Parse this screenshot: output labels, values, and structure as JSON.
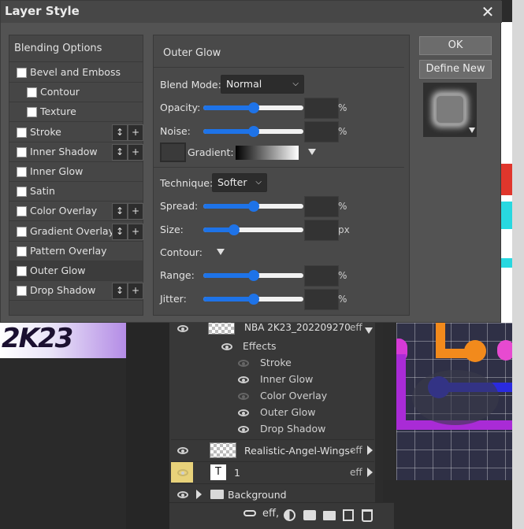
{
  "dialog": {
    "title": "Layer Style",
    "close_glyph": "✕",
    "ok_label": "OK",
    "define_new_label": "Define New",
    "options": {
      "header": "Blending Options",
      "items": [
        {
          "label": "Bevel and Emboss",
          "indent": false,
          "checked": false,
          "controls": false
        },
        {
          "label": "Contour",
          "indent": true,
          "checked": false,
          "controls": false
        },
        {
          "label": "Texture",
          "indent": true,
          "checked": false,
          "controls": false
        },
        {
          "label": "Stroke",
          "indent": false,
          "checked": false,
          "controls": true
        },
        {
          "label": "Inner Shadow",
          "indent": false,
          "checked": false,
          "controls": true
        },
        {
          "label": "Inner Glow",
          "indent": false,
          "checked": false,
          "controls": false
        },
        {
          "label": "Satin",
          "indent": false,
          "checked": false,
          "controls": false
        },
        {
          "label": "Color Overlay",
          "indent": false,
          "checked": false,
          "controls": true
        },
        {
          "label": "Gradient Overlay",
          "indent": false,
          "checked": false,
          "controls": true
        },
        {
          "label": "Pattern Overlay",
          "indent": false,
          "checked": false,
          "controls": false
        },
        {
          "label": "Outer Glow",
          "indent": false,
          "checked": false,
          "controls": false,
          "selected": true
        },
        {
          "label": "Drop Shadow",
          "indent": false,
          "checked": false,
          "controls": true
        }
      ],
      "move_glyph": "↕",
      "add_glyph": "+"
    },
    "effect": {
      "title": "Outer Glow",
      "blend_mode_label": "Blend Mode:",
      "blend_mode_value": "Normal",
      "opacity_label": "Opacity:",
      "opacity_value": 0.5,
      "noise_label": "Noise:",
      "noise_value": 0.5,
      "gradient_label": "Gradient:",
      "technique_label": "Technique:",
      "technique_value": "Softer",
      "spread_label": "Spread:",
      "spread_value": 0.5,
      "size_label": "Size:",
      "size_value": 0.28,
      "contour_label": "Contour:",
      "range_label": "Range:",
      "range_value": 0.5,
      "jitter_label": "Jitter:",
      "jitter_value": 0.5,
      "percent_unit": "%",
      "px_unit": "px"
    }
  },
  "layers": {
    "top_layer_name": "NBA 2K23_202209270",
    "eff_label": "eff",
    "effects_label": "Effects",
    "effects": [
      {
        "label": "Stroke",
        "visible": false
      },
      {
        "label": "Inner Glow",
        "visible": true
      },
      {
        "label": "Color Overlay",
        "visible": false
      },
      {
        "label": "Outer Glow",
        "visible": true
      },
      {
        "label": "Drop Shadow",
        "visible": true
      }
    ],
    "wings_layer_name": "Realistic-Angel-Wings-",
    "text_layer_name": "1",
    "text_layer_glyph": "T",
    "group_name": "Background",
    "toolbar_eff": "eff,"
  },
  "canvas": {
    "left_text": "2K23"
  }
}
